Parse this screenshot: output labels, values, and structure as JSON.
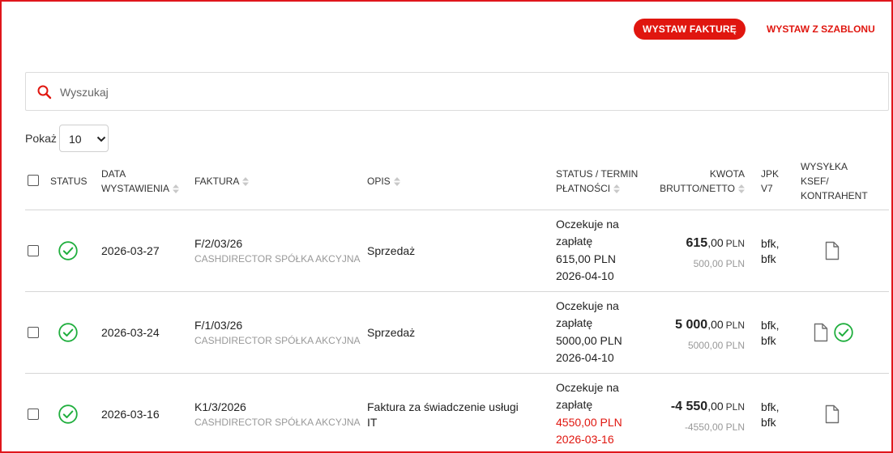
{
  "toolbar": {
    "issue_invoice_label": "WYSTAW FAKTURĘ",
    "issue_from_template_label": "WYSTAW Z SZABLONU"
  },
  "search": {
    "placeholder": "Wyszukaj",
    "value": ""
  },
  "pagination": {
    "show_label": "Pokaż",
    "page_size": "10"
  },
  "table": {
    "headers": {
      "status": "STATUS",
      "issue_date_line1": "DATA",
      "issue_date_line2": "WYSTAWIENIA",
      "invoice": "FAKTURA",
      "description": "OPIS",
      "payment_status_line1": "STATUS / TERMIN",
      "payment_status_line2": "PŁATNOŚCI",
      "amount_line1": "KWOTA",
      "amount_line2": "BRUTTO/NETTO",
      "jpk_line1": "JPK",
      "jpk_line2": "V7",
      "ksef_line1": "WYSYŁKA",
      "ksef_line2": "KSEF/",
      "ksef_line3": "KONTRAHENT"
    },
    "rows": [
      {
        "date": "2026-03-27",
        "number": "F/2/03/26",
        "client": "CASHDIRECTOR SPÓŁKA AKCYJNA",
        "description": "Sprzedaż",
        "pay_status_1": "Oczekuje na",
        "pay_status_2": "zapłatę",
        "pay_amount": "615,00 PLN",
        "due_date": "2026-04-10",
        "overdue": false,
        "gross_int": "615",
        "gross_dec": ",00",
        "currency": "PLN",
        "net": "500,00 PLN",
        "jpk_1": "bfk,",
        "jpk_2": "bfk",
        "ksef_sent": false
      },
      {
        "date": "2026-03-24",
        "number": "F/1/03/26",
        "client": "CASHDIRECTOR SPÓŁKA AKCYJNA",
        "description": "Sprzedaż",
        "pay_status_1": "Oczekuje na",
        "pay_status_2": "zapłatę",
        "pay_amount": "5000,00 PLN",
        "due_date": "2026-04-10",
        "overdue": false,
        "gross_int": "5 000",
        "gross_dec": ",00",
        "currency": "PLN",
        "net": "5000,00 PLN",
        "jpk_1": "bfk,",
        "jpk_2": "bfk",
        "ksef_sent": true
      },
      {
        "date": "2026-03-16",
        "number": "K1/3/2026",
        "client": "CASHDIRECTOR SPÓŁKA AKCYJNA",
        "description_1": "Faktura za świadczenie usługi",
        "description_2": "IT",
        "pay_status_1": "Oczekuje na",
        "pay_status_2": "zapłatę",
        "pay_amount": "4550,00 PLN",
        "due_date": "2026-03-16",
        "overdue": true,
        "gross_int": "-4 550",
        "gross_dec": ",00",
        "currency": "PLN",
        "net": "-4550,00 PLN",
        "jpk_1": "bfk,",
        "jpk_2": "bfk",
        "ksef_sent": false
      }
    ]
  },
  "colors": {
    "accent": "#e0160f",
    "success": "#1fae3d",
    "muted": "#999999",
    "border": "#d6d6d6"
  },
  "icons": {
    "search": "search-icon",
    "status_ok": "check-circle-icon",
    "document": "document-icon",
    "ksef_ok": "check-circle-icon",
    "dropdown": "chevron-down-icon",
    "sort": "sort-icon"
  }
}
